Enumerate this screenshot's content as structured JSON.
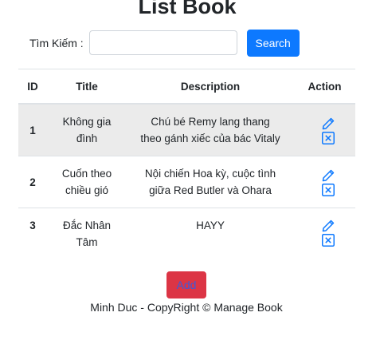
{
  "page": {
    "title": "List Book"
  },
  "search": {
    "label": "Tìm Kiếm :",
    "value": "",
    "placeholder": "",
    "button_label": "Search"
  },
  "table": {
    "headers": {
      "id": "ID",
      "title": "Title",
      "description": "Description",
      "action": "Action"
    },
    "rows": [
      {
        "id": "1",
        "title_line1": "Không gia",
        "title_line2": "đình",
        "desc_line1": "Chú bé Remy lang thang",
        "desc_line2": "theo gánh xiếc của bác Vitaly"
      },
      {
        "id": "2",
        "title_line1": "Cuốn theo",
        "title_line2": "chiều gió",
        "desc_line1": "Nội chiến Hoa kỳ, cuộc tình",
        "desc_line2": "giữa Red Butler và Ohara"
      },
      {
        "id": "3",
        "title_line1": "Đắc Nhân",
        "title_line2": "Tâm",
        "desc_line1": "HAYY",
        "desc_line2": ""
      }
    ],
    "icons": {
      "edit": "pencil-icon",
      "delete": "x-square-icon"
    },
    "stripe_color": "#ebebeb"
  },
  "add_button": {
    "label": "Add"
  },
  "footer": {
    "text": "Minh Duc - CopyRight © Manage Book"
  },
  "colors": {
    "primary": "#0d79ff",
    "danger": "#dc3545",
    "icon": "#0d79ff"
  }
}
